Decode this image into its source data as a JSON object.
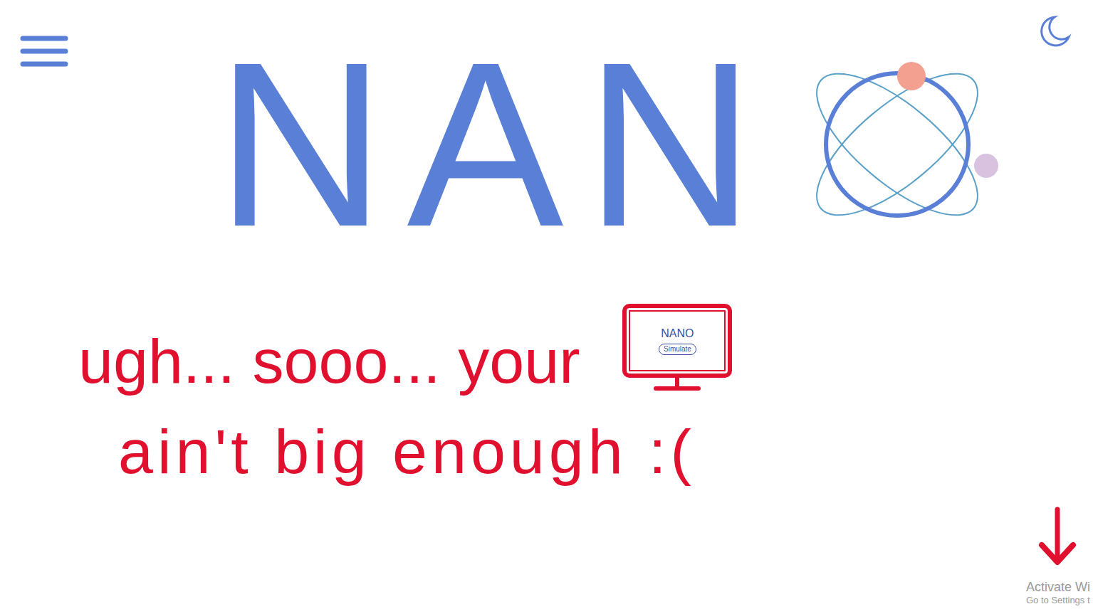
{
  "title": "NAN",
  "message": {
    "line1": "ugh... sooo... your",
    "line2": "ain't big enough :("
  },
  "monitor": {
    "title": "NANO",
    "button": "Simulate"
  },
  "watermark": {
    "line1": "Activate Wi",
    "line2": "Go to Settings t"
  }
}
